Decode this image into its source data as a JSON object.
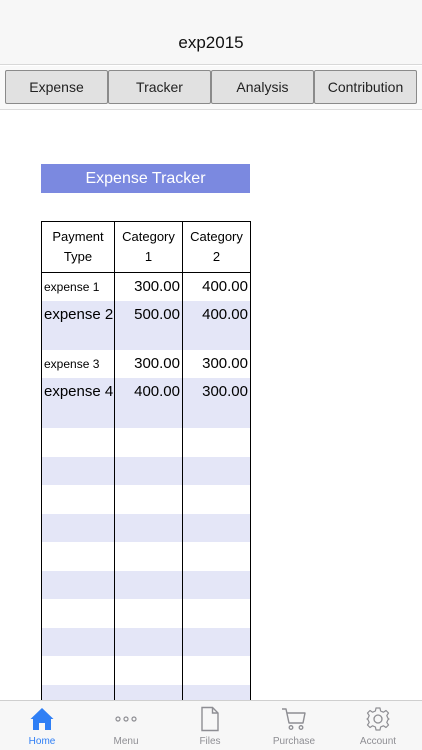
{
  "header": {
    "title": "exp2015"
  },
  "tabs": [
    {
      "label": "Expense"
    },
    {
      "label": "Tracker"
    },
    {
      "label": "Analysis"
    },
    {
      "label": "Contribution"
    }
  ],
  "section": {
    "title": "Expense Tracker"
  },
  "table": {
    "columns": [
      {
        "line1": "Payment",
        "line2": "Type"
      },
      {
        "line1": "Category",
        "line2": "1"
      },
      {
        "line1": "Category",
        "line2": "2"
      }
    ],
    "rows": [
      {
        "label": "expense 1",
        "cat1": "300.00",
        "cat2": "400.00"
      },
      {
        "label": "expense 2",
        "cat1": "500.00",
        "cat2": "400.00"
      },
      {
        "label": "expense 3",
        "cat1": "300.00",
        "cat2": "300.00"
      },
      {
        "label": "expense 4",
        "cat1": "400.00",
        "cat2": "300.00"
      }
    ]
  },
  "bottom_nav": [
    {
      "label": "Home",
      "icon": "home-icon",
      "active": true
    },
    {
      "label": "Menu",
      "icon": "more-icon",
      "active": false
    },
    {
      "label": "Files",
      "icon": "file-icon",
      "active": false
    },
    {
      "label": "Purchase",
      "icon": "cart-icon",
      "active": false
    },
    {
      "label": "Account",
      "icon": "gear-icon",
      "active": false
    }
  ],
  "colors": {
    "accent": "#2f7ff5",
    "section_bg": "#7b89e0",
    "row_alt": "#e4e6f7",
    "nav_inactive": "#8e8e93"
  }
}
